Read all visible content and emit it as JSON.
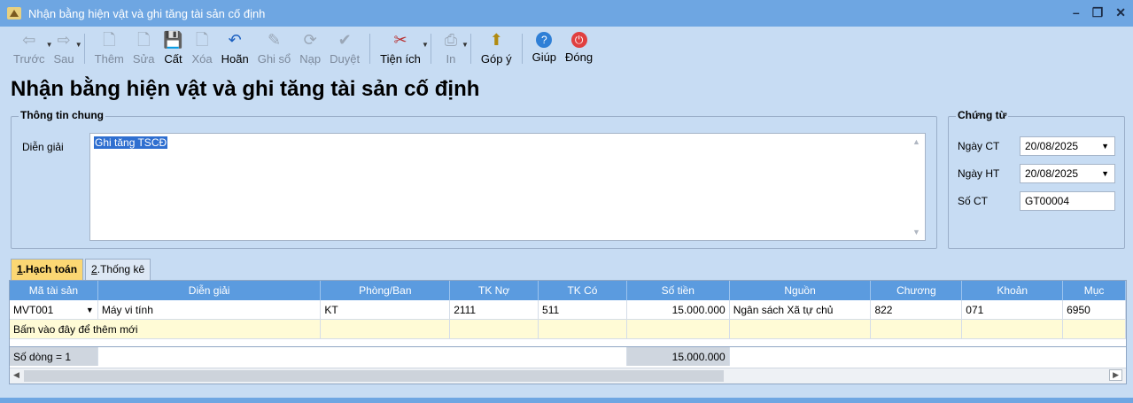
{
  "window": {
    "title": "Nhận bằng hiện vật và ghi tăng tài sản cố định"
  },
  "toolbar": {
    "buttons": [
      {
        "label": "Trước",
        "icon": "arrow-left-icon",
        "glyph": "⇦",
        "enabled": false,
        "dropdown": true
      },
      {
        "label": "Sau",
        "icon": "arrow-right-icon",
        "glyph": "⇨",
        "enabled": false,
        "dropdown": true
      },
      {
        "label": "Thêm",
        "icon": "add-document-icon",
        "glyph": "🗋",
        "enabled": false
      },
      {
        "label": "Sửa",
        "icon": "edit-document-icon",
        "glyph": "🗋",
        "enabled": false
      },
      {
        "label": "Cất",
        "icon": "save-icon",
        "glyph": "💾",
        "enabled": true
      },
      {
        "label": "Xóa",
        "icon": "delete-document-icon",
        "glyph": "🗋",
        "enabled": false
      },
      {
        "label": "Hoãn",
        "icon": "undo-icon",
        "glyph": "↶",
        "enabled": true
      },
      {
        "label": "Ghi sổ",
        "icon": "pencil-icon",
        "glyph": "✎",
        "enabled": false
      },
      {
        "label": "Nạp",
        "icon": "reload-icon",
        "glyph": "⟳",
        "enabled": false
      },
      {
        "label": "Duyệt",
        "icon": "check-icon",
        "glyph": "✔",
        "enabled": false
      },
      {
        "label": "Tiện ích",
        "icon": "tools-icon",
        "glyph": "✂",
        "enabled": true,
        "dropdown": true
      },
      {
        "label": "In",
        "icon": "printer-icon",
        "glyph": "⎙",
        "enabled": false,
        "dropdown": true
      },
      {
        "label": "Góp ý",
        "icon": "feedback-icon",
        "glyph": "⬆",
        "enabled": true
      },
      {
        "label": "Giúp",
        "icon": "help-icon",
        "glyph": "?",
        "enabled": true
      },
      {
        "label": "Đóng",
        "icon": "power-icon",
        "glyph": "⏻",
        "enabled": true
      }
    ]
  },
  "page_title": "Nhận bằng hiện vật và ghi tăng tài sản cố định",
  "general": {
    "legend": "Thông tin chung",
    "description_label": "Diễn giải",
    "description_value": "Ghi tăng TSCĐ"
  },
  "voucher": {
    "legend": "Chứng từ",
    "voucher_date_label": "Ngày CT",
    "voucher_date": "20/08/2025",
    "posting_date_label": "Ngày HT",
    "posting_date": "20/08/2025",
    "number_label": "Số CT",
    "number": "GT00004"
  },
  "tabs": [
    {
      "key": "1",
      "label": "Hạch toán",
      "active": true
    },
    {
      "key": "2",
      "label": "Thống kê",
      "active": false
    }
  ],
  "grid": {
    "columns": [
      "Mã tài sản",
      "Diễn giải",
      "Phòng/Ban",
      "TK Nợ",
      "TK Có",
      "Số tiền",
      "Nguồn",
      "Chương",
      "Khoản",
      "Mục"
    ],
    "rows": [
      [
        "MVT001",
        "Máy vi tính",
        "KT",
        "2111",
        "511",
        "15.000.000",
        "Ngân sách Xã tự chủ",
        "822",
        "071",
        "6950"
      ]
    ],
    "add_row_text": "Bấm vào đây để thêm mới",
    "footer_count": "Số dòng = 1",
    "footer_total": "15.000.000"
  },
  "colors": {
    "titlebar": "#6ea6e2",
    "header": "#5b9bdf",
    "active_tab": "#fbd773",
    "background": "#c7dcf3"
  }
}
